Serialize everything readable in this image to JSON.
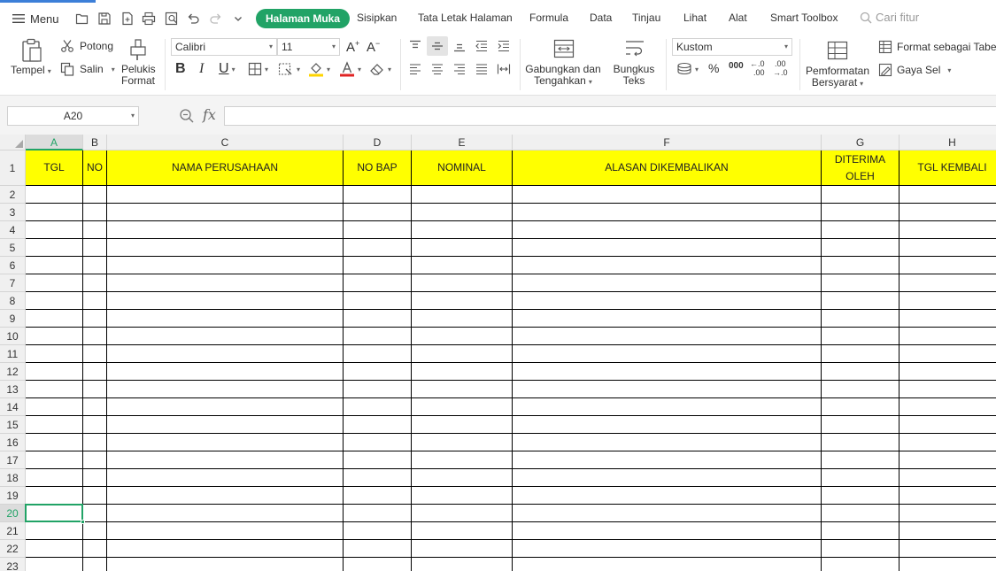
{
  "menubar": {
    "menu_label": "Menu",
    "tabs": [
      "Halaman Muka",
      "Sisipkan",
      "Tata Letak Halaman",
      "Formula",
      "Data",
      "Tinjau",
      "Lihat",
      "Alat",
      "Smart Toolbox"
    ],
    "active_tab": "Halaman Muka",
    "search_placeholder": "Cari fitur"
  },
  "ribbon": {
    "paste_label": "Tempel",
    "cut_label": "Potong",
    "copy_label": "Salin",
    "format_painter_line1": "Pelukis",
    "format_painter_line2": "Format",
    "font_name": "Calibri",
    "font_size": "11",
    "merge_line1": "Gabungkan dan",
    "merge_line2": "Tengahkan",
    "wrap_line1": "Bungkus",
    "wrap_line2": "Teks",
    "number_format": "Kustom",
    "conditional_line1": "Pemformatan",
    "conditional_line2": "Bersyarat",
    "format_as_table": "Format sebagai Tabel",
    "cell_style": "Gaya Sel",
    "thousands_sep": "000",
    "dec_increase_top": "←.0",
    "dec_increase_bottom": ".00",
    "dec_decrease_top": ".00",
    "dec_decrease_bottom": "→.0",
    "accent_green": "#21a366",
    "font_color_bar": "#e02424",
    "fill_color_bar": "#ffd400"
  },
  "formula_bar": {
    "name_box": "A20",
    "fx_label": "fx",
    "formula": ""
  },
  "sheet": {
    "columns": [
      "A",
      "B",
      "C",
      "D",
      "E",
      "F",
      "G",
      "H"
    ],
    "selected_column": "A",
    "rows": [
      "1",
      "2",
      "3",
      "4",
      "5",
      "6",
      "7",
      "8",
      "9",
      "10",
      "11",
      "12",
      "13",
      "14",
      "15",
      "16",
      "17",
      "18",
      "19",
      "20",
      "21",
      "22",
      "23"
    ],
    "selected_row": "20",
    "header_row": [
      "TGL",
      "NO",
      "NAMA PERUSAHAAN",
      "NO BAP",
      "NOMINAL",
      "ALASAN DIKEMBALIKAN",
      "DITERIMA OLEH",
      "TGL KEMBALI"
    ],
    "header_fill": "#ffff00",
    "active_cell": "A20"
  }
}
